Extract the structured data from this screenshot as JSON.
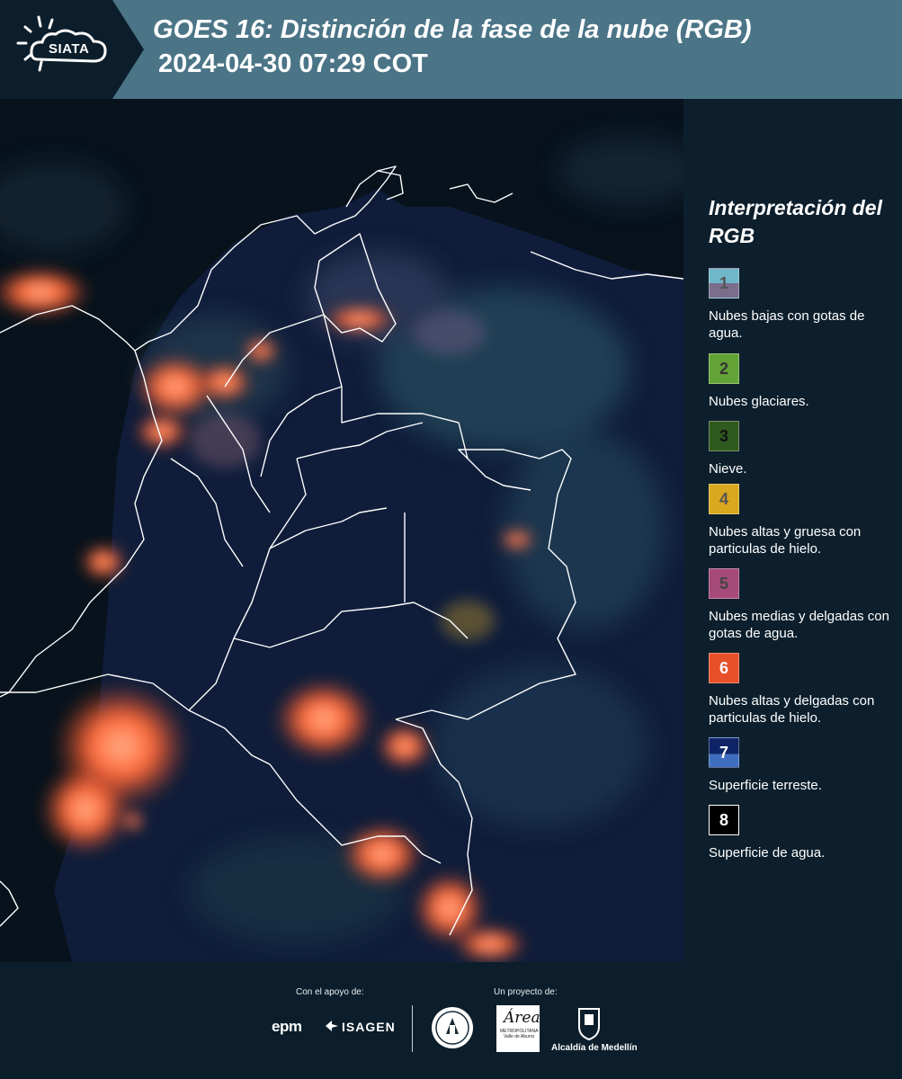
{
  "header": {
    "logo_text": "SIATA",
    "title_line1": "GOES 16: Distinción de la fase de la nube (RGB)",
    "title_line2": "2024-04-30 07:29 COT",
    "background_color": "#4b7587"
  },
  "legend": {
    "title": "Interpretación del RGB",
    "items": [
      {
        "number": "1",
        "label": "Nubes bajas con gotas de agua.",
        "color_top": "#6fb7c9",
        "color_bottom": "#7b6d8c",
        "number_color": "#555555"
      },
      {
        "number": "2",
        "label": "Nubes glaciares.",
        "color_top": "#63a336",
        "color_bottom": "#63a336",
        "number_color": "#333333"
      },
      {
        "number": "3",
        "label": "Nieve.",
        "color_top": "#2f5a1f",
        "color_bottom": "#2f5a1f",
        "number_color": "#111111"
      },
      {
        "number": "4",
        "label": "Nubes altas y gruesa con particulas de hielo.",
        "color_top": "#d9a81e",
        "color_bottom": "#d9a81e",
        "number_color": "#555555"
      },
      {
        "number": "5",
        "label": "Nubes medias y delgadas con gotas de agua.",
        "color_top": "#a54a79",
        "color_bottom": "#a54a79",
        "number_color": "#444444"
      },
      {
        "number": "6",
        "label": "Nubes altas y delgadas con particulas de hielo.",
        "color_top": "#e8502a",
        "color_bottom": "#e8502a",
        "number_color": "#ffffff"
      },
      {
        "number": "7",
        "label": "Superficie terreste.",
        "color_top": "#0e2466",
        "color_bottom": "#3f6ec0",
        "number_color": "#ffffff"
      },
      {
        "number": "8",
        "label": "Superficie de agua.",
        "color_top": "#000000",
        "color_bottom": "#000000",
        "number_color": "#ffffff"
      }
    ]
  },
  "footer": {
    "support_label": "Con el apoyo de:",
    "project_label": "Un proyecto de:",
    "epm": "epm",
    "isagen": "ISAGEN",
    "amva_script": "Área",
    "amva_text": "METROPOLITANA Valle de Aburrá",
    "medellin": "Alcaldía de Medellín"
  },
  "map": {
    "land_color": "#0f1d3a",
    "water_color": "#07121c",
    "cloud_warm": "#ff6a3a",
    "border_color": "#ffffff"
  }
}
